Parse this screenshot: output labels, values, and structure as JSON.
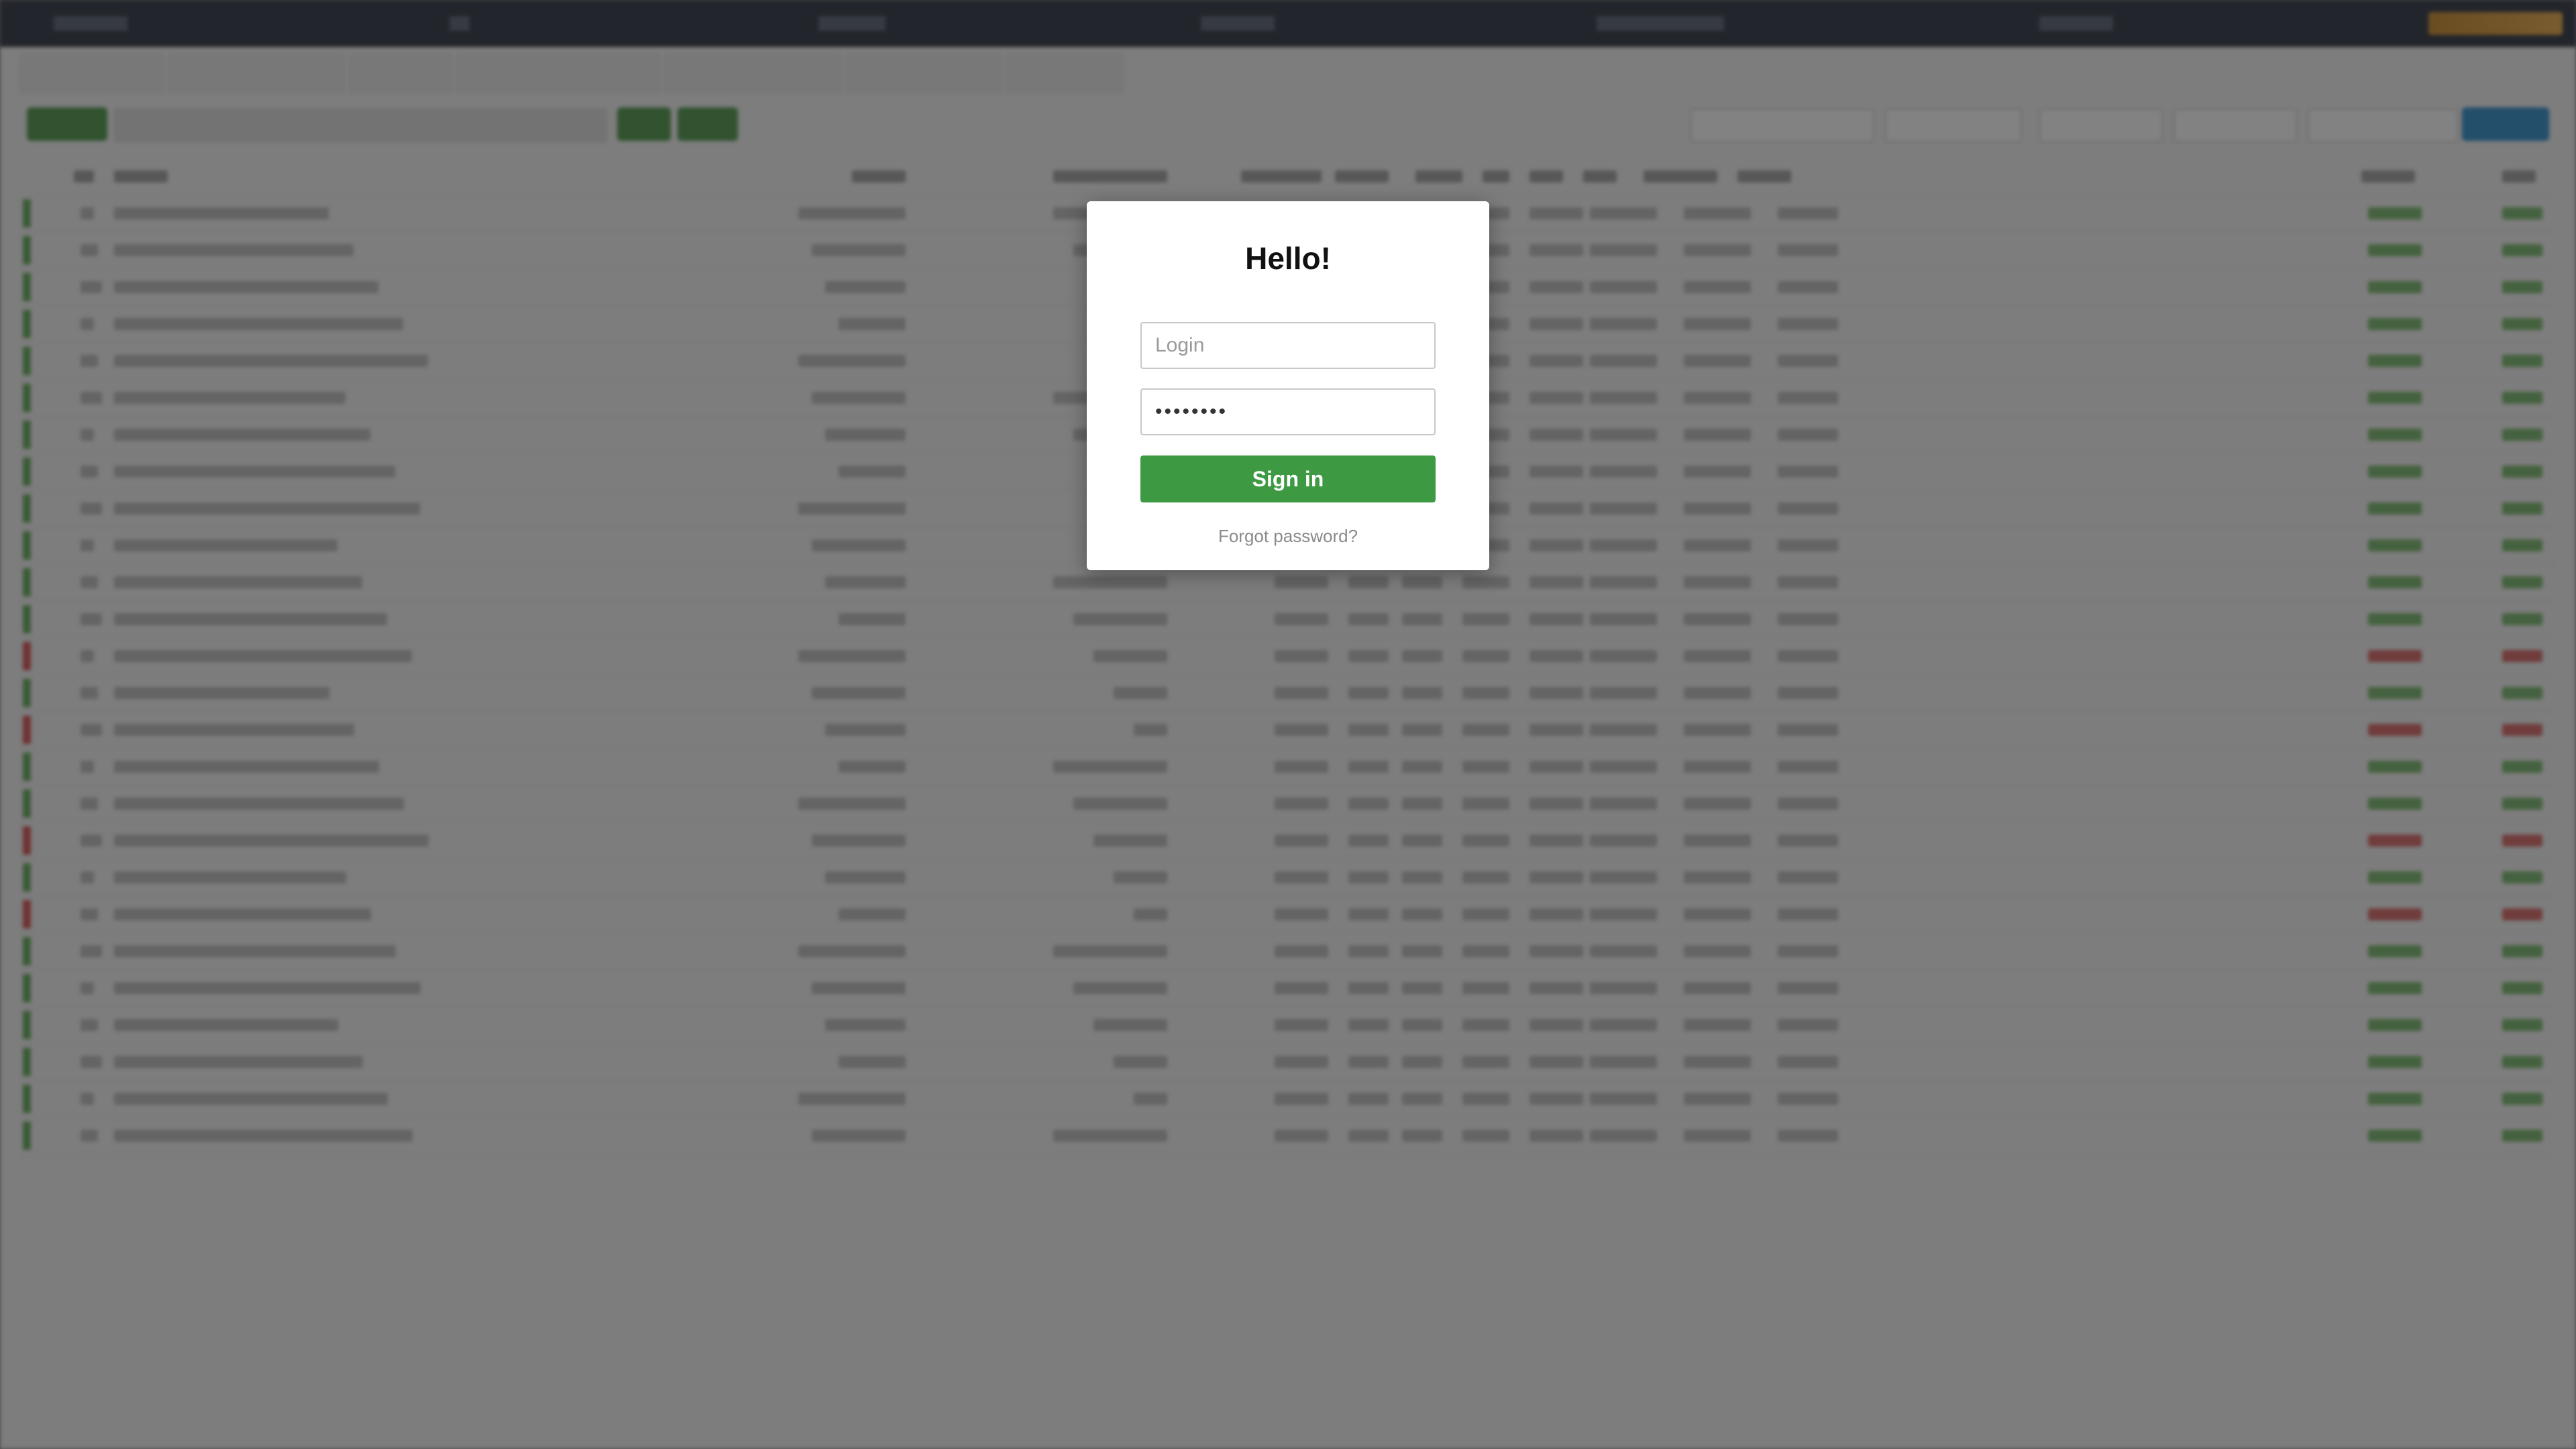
{
  "login_modal": {
    "title": "Hello!",
    "login_placeholder": "Login",
    "password_value": "••••••••",
    "signin_label": "Sign in",
    "forgot_label": "Forgot password?"
  },
  "colors": {
    "signin_button": "#3e9a42",
    "overlay": "rgba(40,40,40,0.58)",
    "topbar": "#1c2330",
    "row_positive": "#57a34b",
    "row_negative": "#d24141"
  }
}
